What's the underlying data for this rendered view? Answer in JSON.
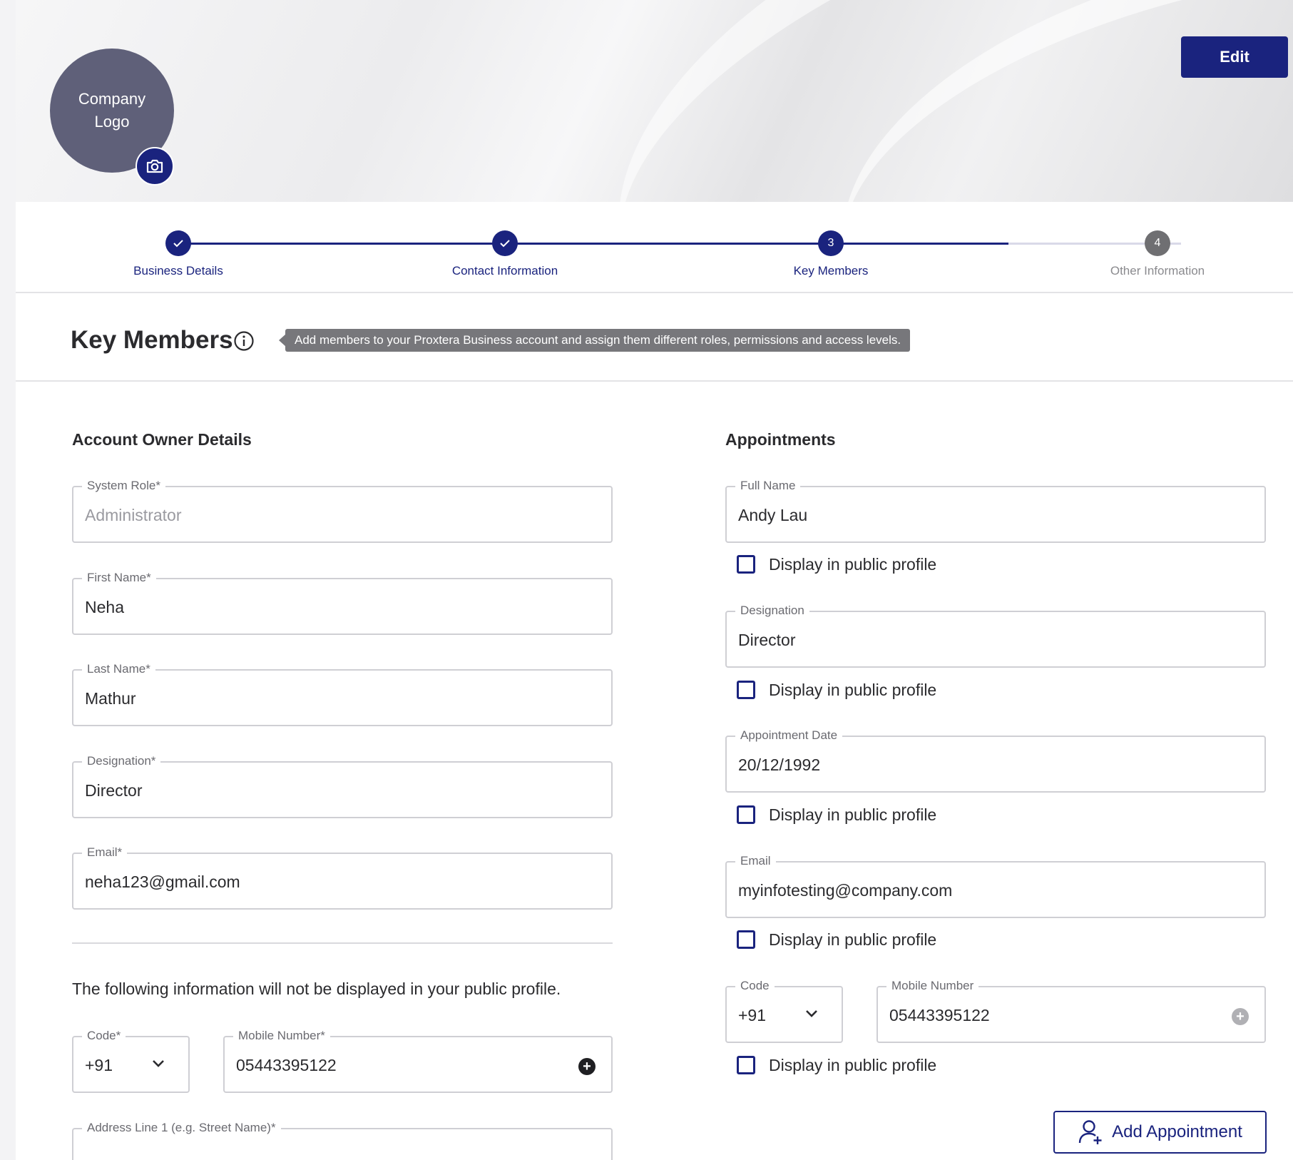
{
  "header": {
    "logo_text": "Company Logo",
    "edit_label": "Edit"
  },
  "stepper": {
    "steps": [
      {
        "label": "Business Details",
        "state": "done",
        "marker": "check-icon"
      },
      {
        "label": "Contact Information",
        "state": "done",
        "marker": "check-icon"
      },
      {
        "label": "Key Members",
        "state": "current",
        "marker": "3"
      },
      {
        "label": "Other Information",
        "state": "todo",
        "marker": "4"
      }
    ]
  },
  "section": {
    "title": "Key Members",
    "tooltip": "Add members to your Proxtera Business account and assign them different roles, permissions and access levels."
  },
  "owner": {
    "title": "Account Owner Details",
    "system_role_label": "System Role*",
    "system_role_value": "Administrator",
    "first_name_label": "First Name*",
    "first_name_value": "Neha",
    "last_name_label": "Last Name*",
    "last_name_value": "Mathur",
    "designation_label": "Designation*",
    "designation_value": "Director",
    "email_label": "Email*",
    "email_value": "neha123@gmail.com",
    "note": "The following information will not be displayed in your public profile.",
    "code_label": "Code*",
    "code_value": "+91",
    "mobile_label": "Mobile Number*",
    "mobile_value": "05443395122",
    "address_label": "Address Line 1 (e.g. Street Name)*",
    "address_value": ""
  },
  "appointments": {
    "title": "Appointments",
    "full_name_label": "Full Name",
    "full_name_value": "Andy Lau",
    "designation_label": "Designation",
    "designation_value": "Director",
    "date_label": "Appointment Date",
    "date_value": "20/12/1992",
    "email_label": "Email",
    "email_value": "myinfotesting@company.com",
    "code_label": "Code",
    "code_value": "+91",
    "mobile_label": "Mobile Number",
    "mobile_value": "05443395122",
    "display_public_label": "Display in public profile",
    "add_label": "Add Appointment"
  },
  "colors": {
    "primary": "#1a237e",
    "muted_step": "#6f6f72",
    "logo_bg": "#5f6079",
    "tooltip_bg": "#77777b"
  }
}
